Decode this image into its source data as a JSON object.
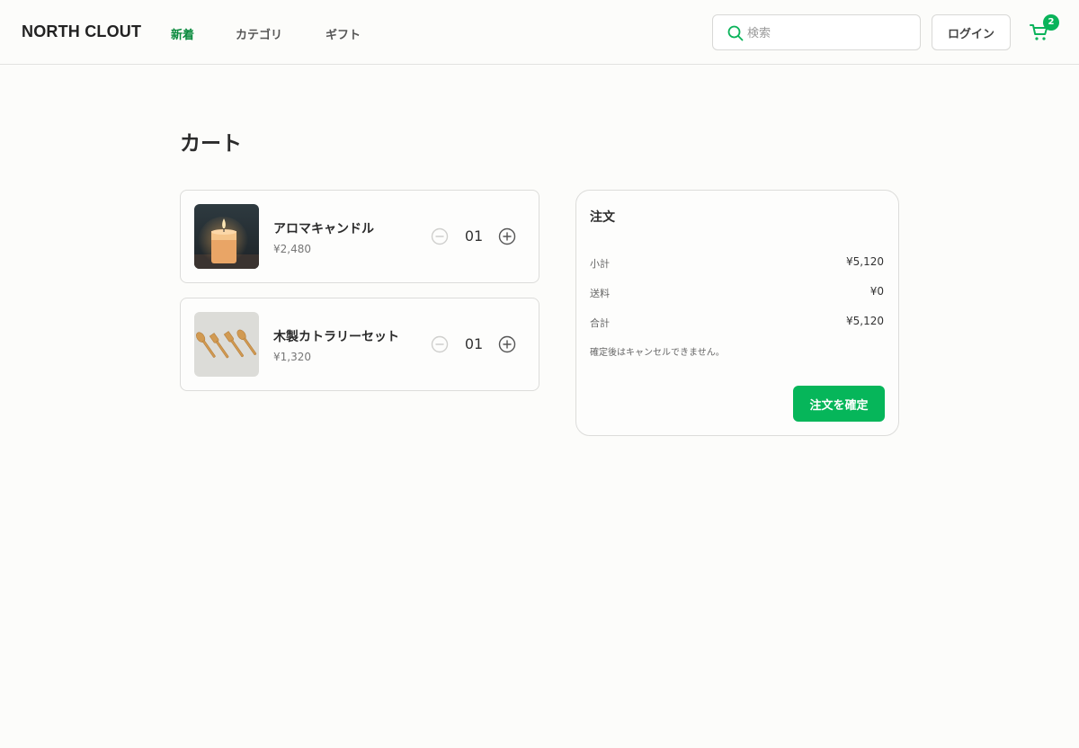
{
  "header": {
    "logo": "NORTH CLOUT",
    "nav": [
      {
        "label": "新着",
        "active": true
      },
      {
        "label": "カテゴリ",
        "active": false
      },
      {
        "label": "ギフト",
        "active": false
      }
    ],
    "search_placeholder": "検索",
    "login_label": "ログイン",
    "cart_count": "2",
    "icons": {
      "search": "search-icon",
      "cart": "cart-icon"
    }
  },
  "main": {
    "title": "カート",
    "items": [
      {
        "name": "アロマキャンドル",
        "price": "¥2,480",
        "quantity": "01",
        "image": "candle-photo"
      },
      {
        "name": "木製カトラリーセット",
        "price": "¥1,320",
        "quantity": "01",
        "image": "wooden-cutlery-photo"
      }
    ]
  },
  "summary": {
    "title": "注文",
    "rows": [
      {
        "label": "小計",
        "value": "¥5,120"
      },
      {
        "label": "送料",
        "value": "¥0"
      },
      {
        "label": "合計",
        "value": "¥5,120"
      }
    ],
    "note": "確定後はキャンセルできません。",
    "confirm_label": "注文を確定"
  },
  "colors": {
    "accent": "#06b65a",
    "nav_active": "#0a8a3e",
    "background": "#fcfcfa",
    "border": "#dcdcda"
  }
}
